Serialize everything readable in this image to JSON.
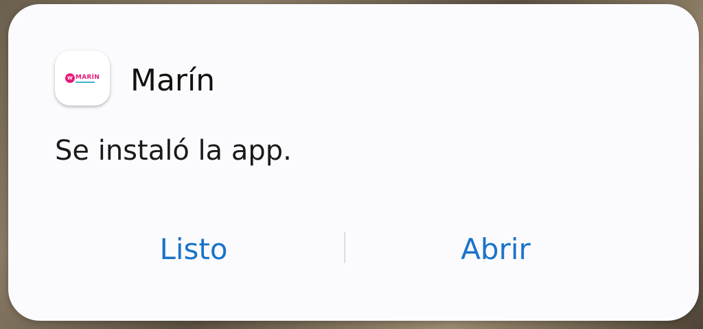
{
  "dialog": {
    "app_name": "Marín",
    "app_logo_text": "MARÍN",
    "app_logo_badge": "W",
    "message": "Se instaló la app.",
    "buttons": {
      "done_label": "Listo",
      "open_label": "Abrir"
    }
  },
  "colors": {
    "accent": "#1a73c9",
    "brand_pink": "#e6197a",
    "brand_teal": "#3fb3c9",
    "dialog_bg": "#fbfafd"
  },
  "icons": {
    "app_icon": "marin-app-icon"
  }
}
